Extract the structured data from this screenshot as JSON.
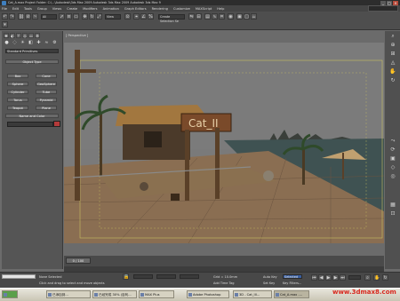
{
  "titlebar": {
    "title": "Cat_A.max   Project Folder: C:\\...\\Autodesk\\3ds Max 2009   Autodesk 3ds Max 2009   Autodesk 3ds Max 9"
  },
  "menu": [
    "File",
    "Edit",
    "Tools",
    "Group",
    "Views",
    "Create",
    "Modifiers",
    "Animation",
    "Graph Editors",
    "Rendering",
    "Customize",
    "MAXScript",
    "Help"
  ],
  "toolbar": {
    "selection_filter": "All",
    "view_dropdown": "View",
    "named_selection": "Create Selection Se"
  },
  "left_panel": {
    "category_dropdown": "Standard Primitives",
    "object_type_title": "Object Type",
    "name_color_title": "Name and Color",
    "objects": [
      "Box",
      "Cone",
      "Sphere",
      "GeoSphere",
      "Cylinder",
      "Tube",
      "Torus",
      "Pyramid",
      "Teapot",
      "Plane"
    ]
  },
  "viewport": {
    "label": "[ Perspective ]",
    "sign_text": "Cat_II"
  },
  "timeline": {
    "slider": "0 / 100"
  },
  "status": {
    "selection": "None Selected",
    "prompt": "Click and drag to select and move objects",
    "grid": "Grid = 10.0mm",
    "add_time_tag": "Add Time Tag",
    "auto_key": "Auto Key",
    "key_filter_value": "Selected",
    "set_key": "Set Key",
    "key_filters": "Key Filters..."
  },
  "taskbar": {
    "start": "",
    "tasks": [
      "已添加到...",
      "已经完成 30% (百利...",
      "MAX Plus",
      "Adobe Photoshop",
      "3D - Cat_III...",
      "Cat_A.max -..."
    ]
  },
  "watermark": "www.3dmax8.com",
  "colors": {
    "accent": "#3f7fbf",
    "swatch": "#b43a3a",
    "watermark": "#d8281e"
  }
}
